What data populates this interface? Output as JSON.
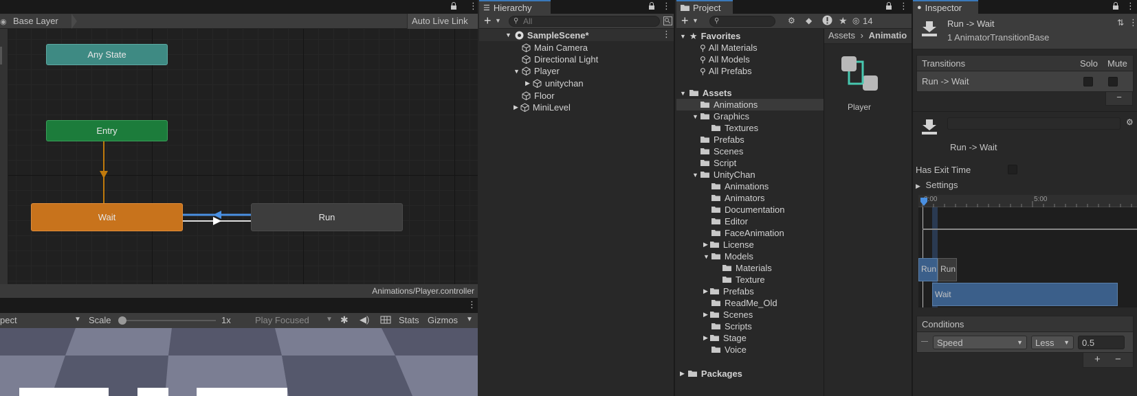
{
  "animator": {
    "breadcrumb": "Base Layer",
    "auto_live_link": "Auto Live Link",
    "footer_path": "Animations/Player.controller",
    "states": {
      "any_state": "Any State",
      "entry": "Entry",
      "wait": "Wait",
      "run": "Run"
    },
    "colors": {
      "any_state": "#3e8a83",
      "entry": "#1c7c3b",
      "wait": "#c8731c",
      "run": "#3d3d3d",
      "transition_selected": "#4a90e2"
    }
  },
  "scene": {
    "left_dropdown": "pect",
    "scale_label": "Scale",
    "scale_value": "1x",
    "play_focused": "Play Focused",
    "stats": "Stats",
    "gizmos": "Gizmos"
  },
  "hierarchy": {
    "title": "Hierarchy",
    "search_placeholder": "All",
    "scene_name": "SampleScene*",
    "items": [
      {
        "label": "Main Camera"
      },
      {
        "label": "Directional Light"
      },
      {
        "label": "Player"
      },
      {
        "label": "unitychan"
      },
      {
        "label": "Floor"
      },
      {
        "label": "MiniLevel"
      }
    ]
  },
  "project": {
    "title": "Project",
    "hidden_count": "14",
    "favorites": "Favorites",
    "favorite_items": [
      "All Materials",
      "All Models",
      "All Prefabs"
    ],
    "assets": "Assets",
    "folders": [
      "Animations",
      "Graphics",
      "Textures",
      "Prefabs",
      "Scenes",
      "Script",
      "UnityChan",
      "Animations",
      "Animators",
      "Documentation",
      "Editor",
      "FaceAnimation",
      "License",
      "Models",
      "Materials",
      "Texture",
      "Prefabs",
      "ReadMe_Old",
      "Scenes",
      "Scripts",
      "Stage",
      "Voice"
    ],
    "packages": "Packages",
    "breadcrumb_root": "Assets",
    "breadcrumb_current": "Animatio",
    "asset_name": "Player"
  },
  "inspector": {
    "title": "Inspector",
    "header_title": "Run -> Wait",
    "header_subtitle": "1 AnimatorTransitionBase",
    "transitions_label": "Transitions",
    "solo": "Solo",
    "mute": "Mute",
    "transition_row": "Run -> Wait",
    "minus": "−",
    "plus": "+",
    "detail_name": "Run -> Wait",
    "has_exit_time": "Has Exit Time",
    "settings": "Settings",
    "timeline_tick_0": "0:00",
    "timeline_tick_1": "5:00",
    "timeline_run_a": "Run",
    "timeline_run_b": "Run",
    "timeline_wait": "Wait",
    "conditions": "Conditions",
    "condition_param": "Speed",
    "condition_op": "Less",
    "condition_value": "0.5"
  }
}
